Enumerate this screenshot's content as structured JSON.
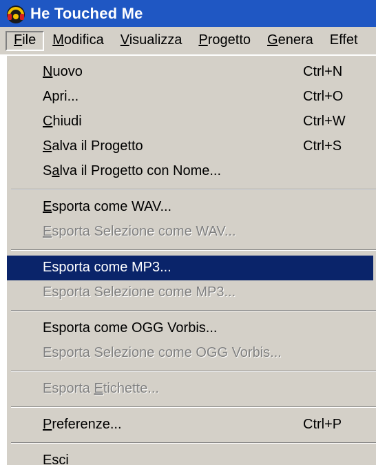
{
  "window": {
    "title": "He Touched Me",
    "icon": "audacity-headphones-icon"
  },
  "menubar": {
    "items": [
      "File",
      "Modifica",
      "Visualizza",
      "Progetto",
      "Genera",
      "Effet"
    ]
  },
  "file_menu": {
    "items": [
      {
        "label": "Nuovo",
        "shortcut": "Ctrl+N"
      },
      {
        "label": "Apri...",
        "shortcut": "Ctrl+O"
      },
      {
        "label": "Chiudi",
        "shortcut": "Ctrl+W"
      },
      {
        "label": "Salva il Progetto",
        "shortcut": "Ctrl+S"
      },
      {
        "label": "Salva il Progetto con Nome...",
        "shortcut": ""
      },
      {
        "label": "Esporta come WAV...",
        "shortcut": ""
      },
      {
        "label": "Esporta Selezione come WAV...",
        "shortcut": ""
      },
      {
        "label": "Esporta come MP3...",
        "shortcut": ""
      },
      {
        "label": "Esporta Selezione come MP3...",
        "shortcut": ""
      },
      {
        "label": "Esporta come OGG Vorbis...",
        "shortcut": ""
      },
      {
        "label": "Esporta Selezione come OGG Vorbis...",
        "shortcut": ""
      },
      {
        "label": "Esporta Etichette...",
        "shortcut": ""
      },
      {
        "label": "Preferenze...",
        "shortcut": "Ctrl+P"
      },
      {
        "label": "Esci",
        "shortcut": ""
      }
    ]
  },
  "colors": {
    "titlebar": "#1f57c3",
    "menu_background": "#d4d0c8",
    "selection": "#0a246a",
    "disabled_text": "#808080"
  }
}
